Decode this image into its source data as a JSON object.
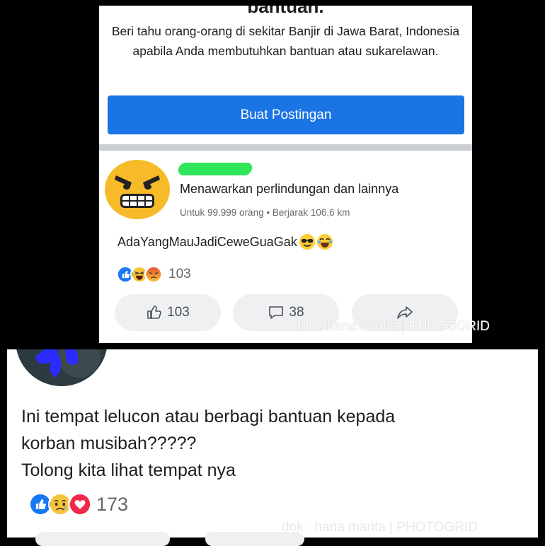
{
  "top_card": {
    "heading_cut": "bantuan.",
    "help_text": "Beri tahu orang-orang di sekitar Banjir di Jawa Barat, Indonesia apabila Anda membutuhkan bantuan atau sukarelawan.",
    "create_post_label": "Buat Postingan"
  },
  "post": {
    "title": "Menawarkan perlindungan dan lainnya",
    "meta": "Untuk 99.999 orang • Berjarak 106,6 km",
    "body": "AdaYangMauJadiCeweGuaGak",
    "reaction_count": "103",
    "like_count": "103",
    "comment_count": "38",
    "watermark": "dok : hana marita | PHOTOGRID"
  },
  "comment": {
    "text_line1": "Ini tempat lelucon atau berbagi bantuan kepada",
    "text_line2": "korban musibah?????",
    "text_line3": "Tolong kita lihat tempat nya",
    "reaction_count": "173",
    "watermark": "dok : hana marita | PHOTOGRID"
  },
  "colors": {
    "accent": "#1b74e4",
    "divider": "#c9ccd1",
    "name_redaction": "#2fe65a",
    "avatar_redaction": "#2b2bff"
  }
}
